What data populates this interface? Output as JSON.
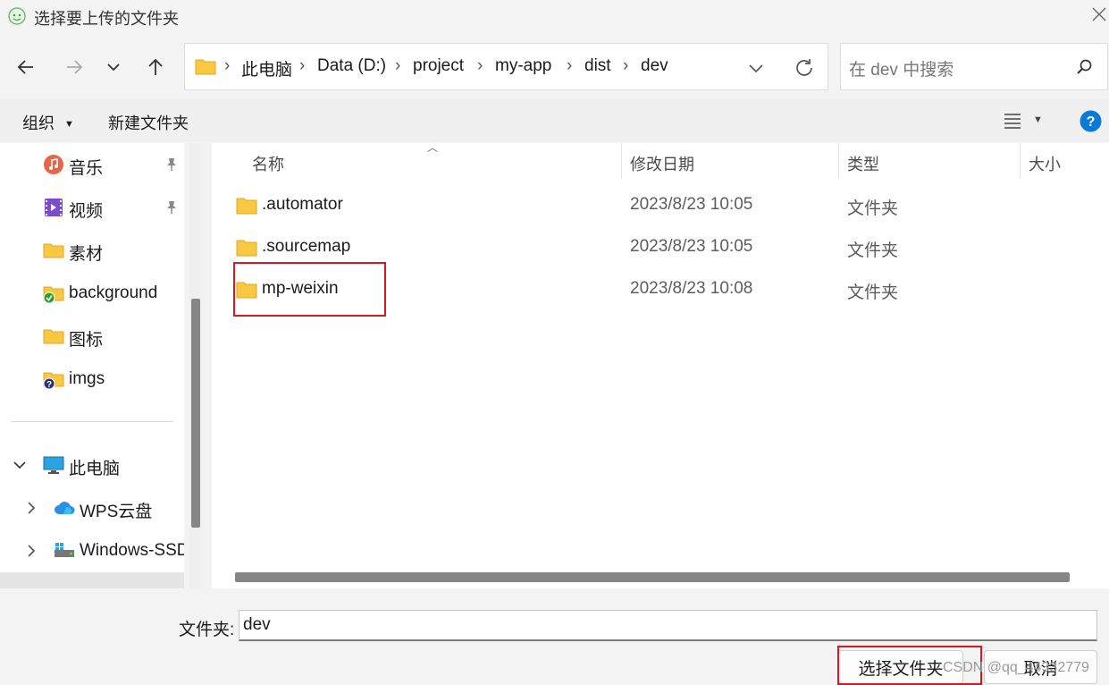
{
  "window": {
    "title": "选择要上传的文件夹"
  },
  "breadcrumb": [
    "此电脑",
    "Data (D:)",
    "project",
    "my-app",
    "dist",
    "dev"
  ],
  "search": {
    "placeholder": "在 dev 中搜索"
  },
  "toolbar": {
    "organize": "组织",
    "new_folder": "新建文件夹"
  },
  "sidebar": {
    "items": [
      {
        "label": "音乐",
        "icon": "music-icon",
        "pinned": true
      },
      {
        "label": "视频",
        "icon": "video-icon",
        "pinned": true
      },
      {
        "label": "素材",
        "icon": "folder-icon",
        "pinned": false
      },
      {
        "label": "background",
        "icon": "folder-sync-ok-icon",
        "pinned": false
      },
      {
        "label": "图标",
        "icon": "folder-icon",
        "pinned": false
      },
      {
        "label": "imgs",
        "icon": "folder-help-icon",
        "pinned": false
      }
    ],
    "this_pc": {
      "label": "此电脑",
      "icon": "monitor-icon"
    },
    "drives": [
      {
        "label": "WPS云盘",
        "icon": "cloud-icon"
      },
      {
        "label": "Windows-SSD",
        "icon": "drive-icon"
      }
    ]
  },
  "columns": {
    "name": "名称",
    "modified": "修改日期",
    "type": "类型",
    "size": "大小"
  },
  "files": [
    {
      "name": ".automator",
      "modified": "2023/8/23 10:05",
      "type": "文件夹"
    },
    {
      "name": ".sourcemap",
      "modified": "2023/8/23 10:05",
      "type": "文件夹"
    },
    {
      "name": "mp-weixin",
      "modified": "2023/8/23 10:08",
      "type": "文件夹"
    }
  ],
  "footer": {
    "folder_label": "文件夹:",
    "folder_value": "dev",
    "select_button": "选择文件夹",
    "cancel_button": "取消"
  },
  "watermark": "CSDN @qq_44332779",
  "colors": {
    "highlight": "#e0141c",
    "folder": "#f8c843",
    "accent": "#0067c0"
  }
}
